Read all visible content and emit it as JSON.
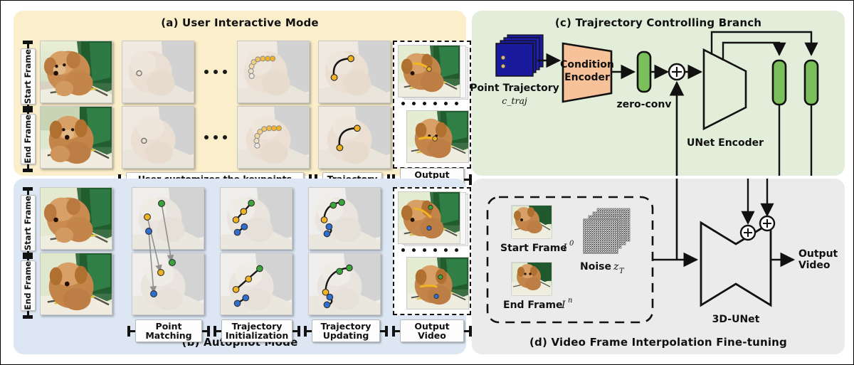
{
  "figure": {
    "panels": {
      "a": {
        "title": "(a) User Interactive Mode",
        "row_labels": [
          "Start Frame",
          "End Frame"
        ],
        "steps": [
          {
            "name": "user-customizes-keypoints",
            "label": "User customizes the keypoints",
            "line2": ""
          },
          {
            "name": "trajectory",
            "label": "Trajectory",
            "line2": ""
          },
          {
            "name": "output-video",
            "label": "Output Video",
            "line2": ""
          }
        ],
        "ellipsis_dots": 3
      },
      "b": {
        "title": "(b) Autopilot Mode",
        "row_labels": [
          "Start Frame",
          "End Frame"
        ],
        "steps": [
          {
            "name": "point-matching",
            "label": "Point",
            "line2": "Matching"
          },
          {
            "name": "trajectory-initialization",
            "label": "Trajectory",
            "line2": "Initialization"
          },
          {
            "name": "trajectory-updating",
            "label": "Trajectory",
            "line2": "Updating"
          },
          {
            "name": "output-video",
            "label": "Output Video",
            "line2": ""
          }
        ]
      },
      "c": {
        "title": "(c) Trajrectory Controlling Branch",
        "nodes": {
          "point_trajectory": "Point Trajectory",
          "point_trajectory_sub": "c_traj",
          "condition_encoder_l1": "Condition",
          "condition_encoder_l2": "Encoder",
          "zero_conv": "zero-conv",
          "unet_encoder": "UNet Encoder",
          "plus": "+"
        }
      },
      "d": {
        "title": "(d) Video Frame Interpolation Fine-tuning",
        "nodes": {
          "start_frame": "Start Frame",
          "start_frame_sym": "I",
          "start_frame_sup": "0",
          "end_frame": "End Frame",
          "end_frame_sym": "I",
          "end_frame_sup": "n",
          "noise": "Noise",
          "noise_sym": "z",
          "noise_sub": "T",
          "unet3d": "3D-UNet",
          "output_video_l1": "Output",
          "output_video_l2": "Video",
          "plus": "+"
        }
      }
    },
    "colors": {
      "panel_a_bg": "#fbeecb",
      "panel_b_bg": "#dce7f3",
      "panel_c_bg": "#e2edda",
      "panel_d_bg": "#ebebeb",
      "condition_encoder": "#f7c19a",
      "zero_conv": "#7bbf5c",
      "point_trajectory": "#1a1a9c",
      "keypoint_yellow": "#f0b323",
      "keypoint_green": "#3aa63a",
      "keypoint_blue": "#2f6fd0",
      "stroke": "#111111"
    }
  }
}
